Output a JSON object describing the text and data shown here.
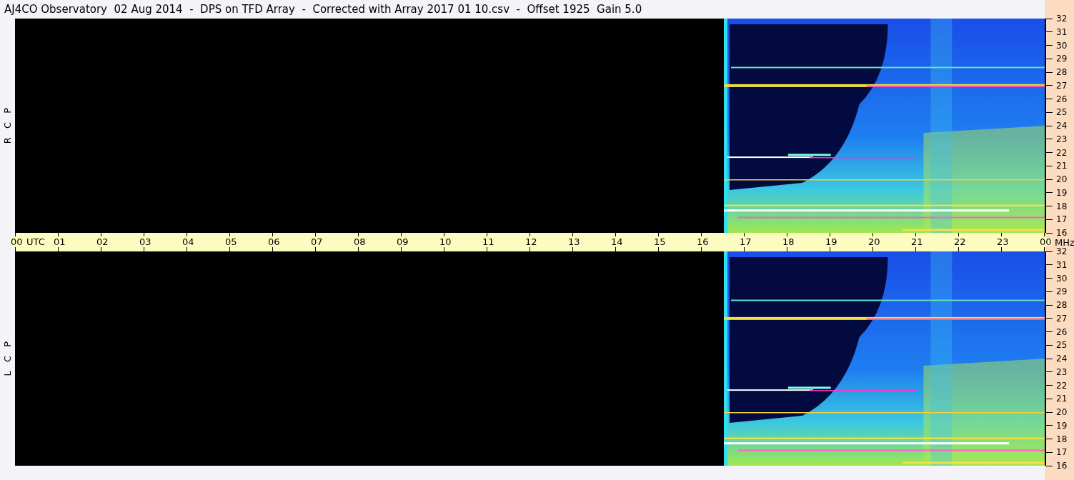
{
  "title": "AJ4CO Observatory  02 Aug 2014  -  DPS on TFD Array  -  Corrected with Array 2017 01 10.csv  -  Offset 1925  Gain 5.0",
  "panels": [
    {
      "label": "R C P",
      "frequency_labels": [
        "32",
        "31",
        "30",
        "29",
        "28",
        "27",
        "26",
        "25",
        "24",
        "23",
        "22",
        "21",
        "20",
        "19",
        "18",
        "17",
        "16"
      ]
    },
    {
      "label": "L C P",
      "frequency_labels": [
        "32",
        "31",
        "30",
        "29",
        "28",
        "27",
        "26",
        "25",
        "24",
        "23",
        "22",
        "21",
        "20",
        "19",
        "18",
        "17",
        "16"
      ]
    }
  ],
  "time_axis": {
    "labels": [
      "00",
      "01",
      "02",
      "03",
      "04",
      "05",
      "06",
      "07",
      "08",
      "09",
      "10",
      "11",
      "12",
      "13",
      "14",
      "15",
      "16",
      "17",
      "18",
      "19",
      "20",
      "21",
      "22",
      "23",
      "00"
    ],
    "time_unit": "UTC",
    "frequency_unit": "MHz"
  }
}
